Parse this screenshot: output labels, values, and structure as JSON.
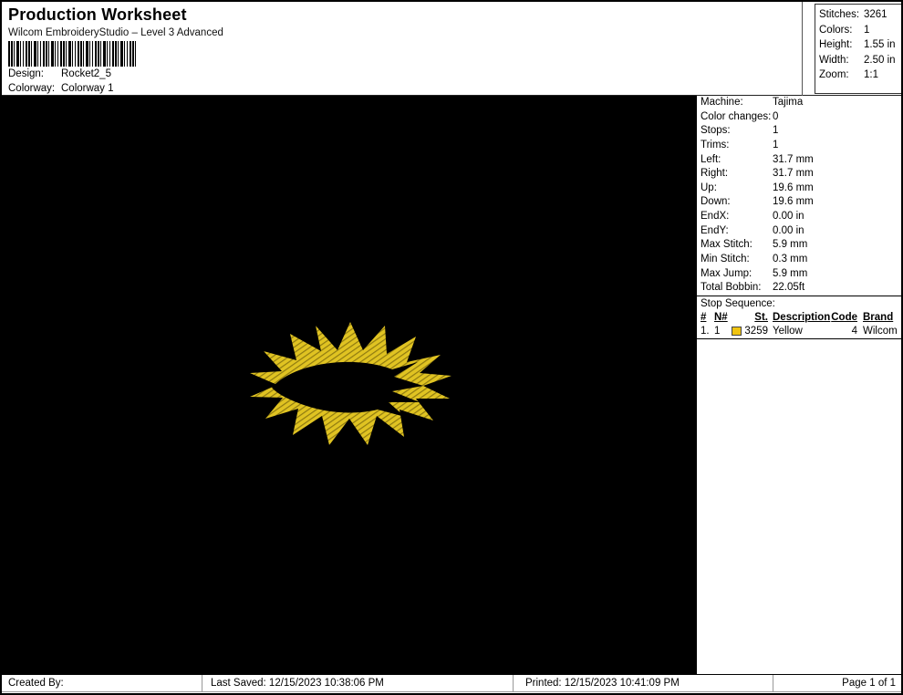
{
  "header": {
    "title": "Production Worksheet",
    "subtitle": "Wilcom EmbroideryStudio – Level 3 Advanced",
    "design_label": "Design:",
    "design_value": "Rocket2_5",
    "colorway_label": "Colorway:",
    "colorway_value": "Colorway 1",
    "stats": [
      {
        "label": "Stitches:",
        "value": "3261"
      },
      {
        "label": "Colors:",
        "value": "1"
      },
      {
        "label": "Height:",
        "value": "1.55 in"
      },
      {
        "label": "Width:",
        "value": "2.50 in"
      },
      {
        "label": "Zoom:",
        "value": "1:1"
      }
    ]
  },
  "machine_info": [
    {
      "label": "Machine:",
      "value": "Tajima"
    },
    {
      "label": "Color changes:",
      "value": "0"
    },
    {
      "label": "Stops:",
      "value": "1"
    },
    {
      "label": "Trims:",
      "value": "1"
    },
    {
      "label": "Left:",
      "value": "31.7 mm"
    },
    {
      "label": "Right:",
      "value": "31.7 mm"
    },
    {
      "label": "Up:",
      "value": "19.6 mm"
    },
    {
      "label": "Down:",
      "value": "19.6 mm"
    },
    {
      "label": "EndX:",
      "value": "0.00 in"
    },
    {
      "label": "EndY:",
      "value": "0.00 in"
    },
    {
      "label": "Max Stitch:",
      "value": "5.9 mm"
    },
    {
      "label": "Min Stitch:",
      "value": "0.3 mm"
    },
    {
      "label": "Max Jump:",
      "value": "5.9 mm"
    },
    {
      "label": "Total Bobbin:",
      "value": "22.05ft"
    }
  ],
  "stop_sequence": {
    "title": "Stop Sequence:",
    "columns": [
      "#",
      "N#",
      "St.",
      "Description",
      "Code",
      "Brand"
    ],
    "rows": [
      {
        "num": "1.",
        "n": "1",
        "st": "3259",
        "description": "Yellow",
        "code": "4",
        "brand": "Wilcom",
        "swatch_color": "#F0C411"
      }
    ]
  },
  "canvas": {
    "background": "#000000",
    "design_yellow": "#E0C322",
    "stitch_shadow": "#8F7A10",
    "rocket_color": "#000000"
  },
  "footer": {
    "created_by": "Created By:",
    "last_saved": "Last Saved: 12/15/2023 10:38:06 PM",
    "printed": "Printed: 12/15/2023 10:41:09 PM",
    "page": "Page 1 of 1"
  }
}
